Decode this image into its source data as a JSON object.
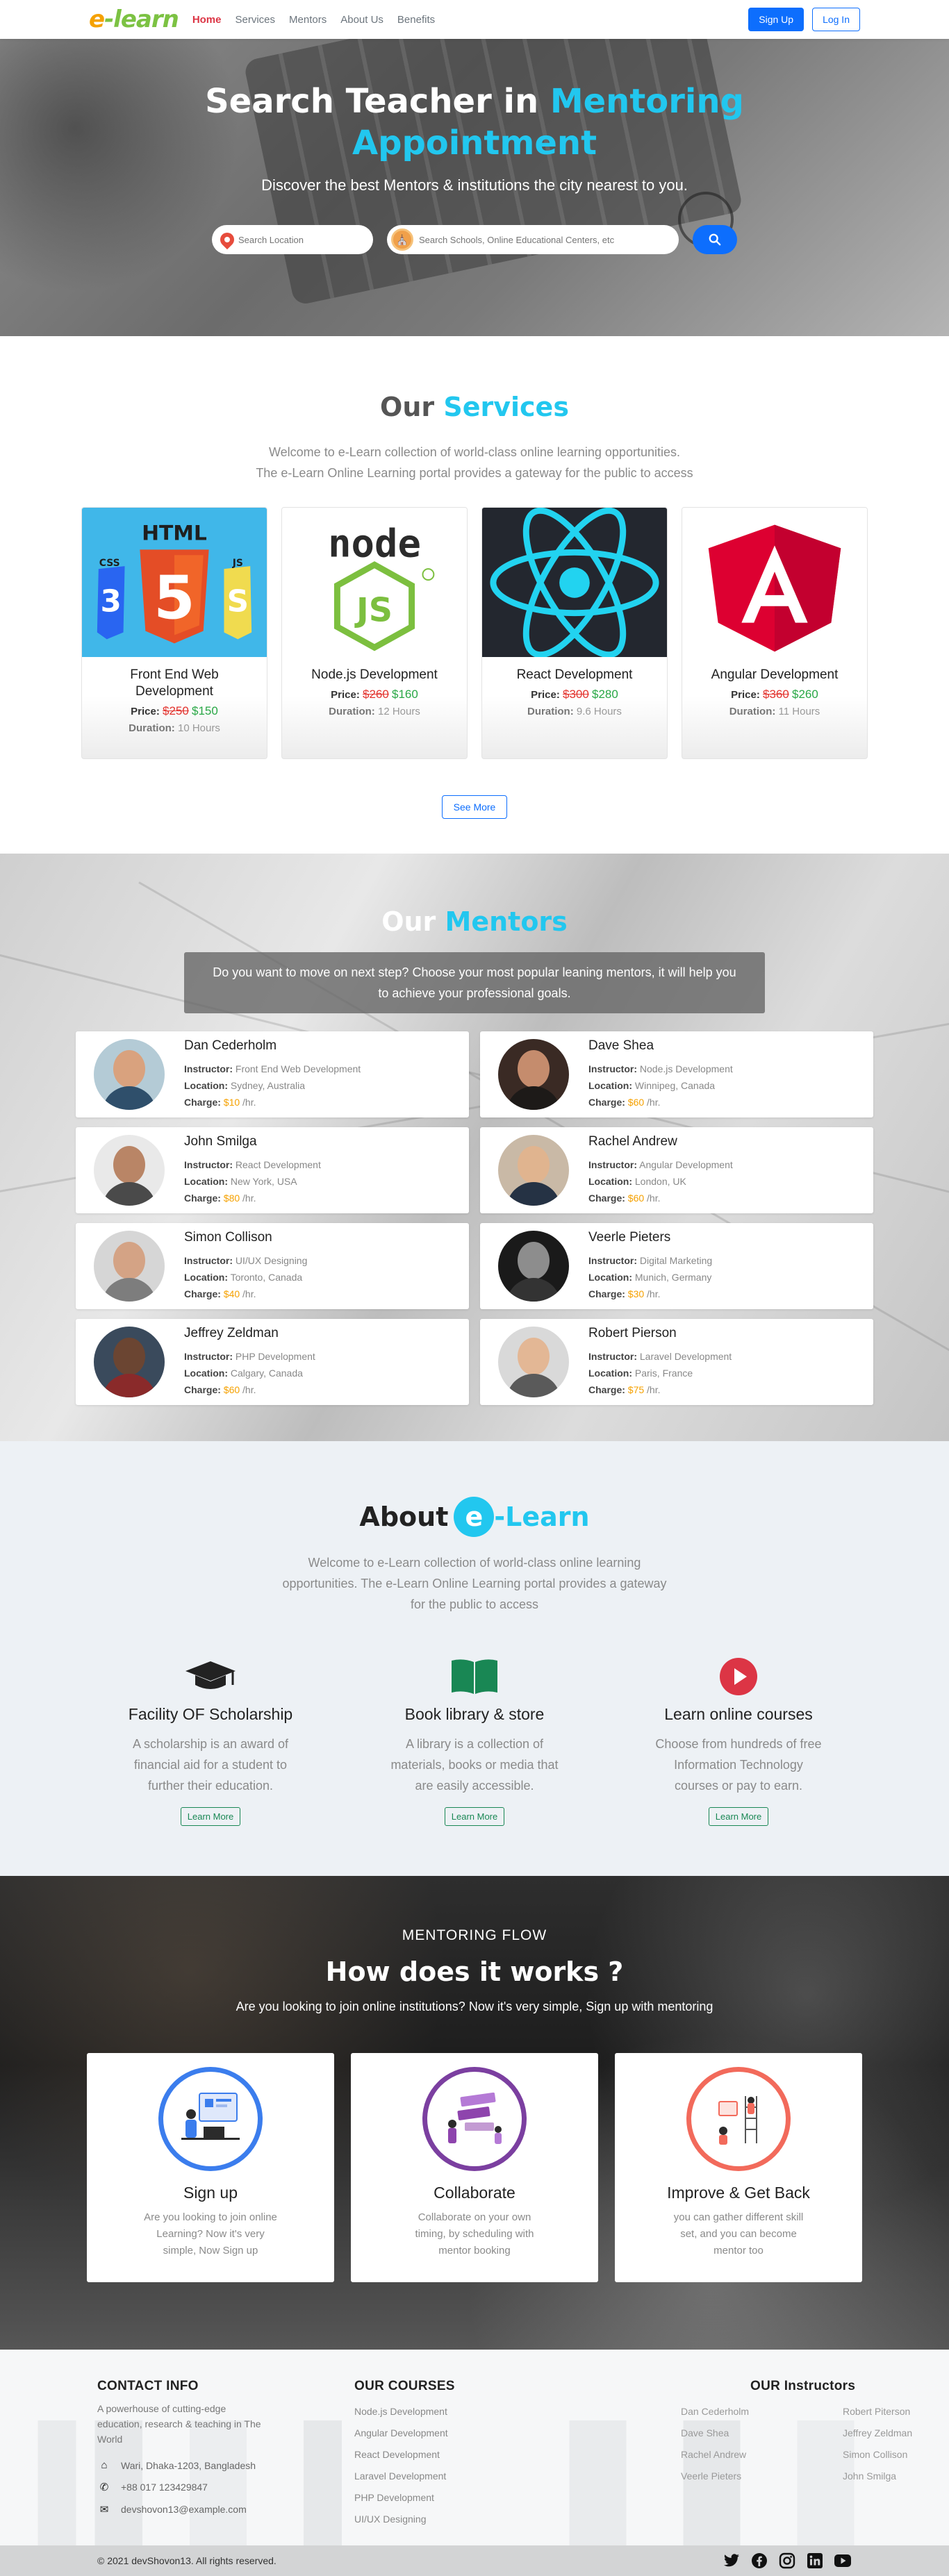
{
  "nav": {
    "logo_e": "e",
    "logo_rest": "-learn",
    "links": [
      "Home",
      "Services",
      "Mentors",
      "About Us",
      "Benefits"
    ],
    "signup": "Sign Up",
    "login": "Log In"
  },
  "hero": {
    "title_plain": "Search Teacher in ",
    "title_highlight": "Mentoring Appointment",
    "subtitle": "Discover the best Mentors & institutions the city nearest to you.",
    "location_placeholder": "Search Location",
    "search_placeholder": "Search Schools, Online Educational Centers, etc"
  },
  "services": {
    "title_plain": "Our ",
    "title_highlight": "Services",
    "desc_line1": "Welcome to e-Learn collection of world-class online learning opportunities.",
    "desc_line2": "The e-Learn Online Learning portal provides a gateway for the public to access",
    "price_label": "Price:",
    "duration_label": "Duration:",
    "see_more": "See More",
    "courses": [
      {
        "title": "Front End Web Development",
        "old_price": "$250",
        "new_price": "$150",
        "duration": "10 Hours",
        "icon": "html-css-js-logo"
      },
      {
        "title": "Node.js Development",
        "old_price": "$260",
        "new_price": "$160",
        "duration": "12 Hours",
        "icon": "nodejs-logo"
      },
      {
        "title": "React Development",
        "old_price": "$300",
        "new_price": "$280",
        "duration": "9.6 Hours",
        "icon": "react-logo"
      },
      {
        "title": "Angular Development",
        "old_price": "$360",
        "new_price": "$260",
        "duration": "11 Hours",
        "icon": "angular-logo"
      }
    ]
  },
  "mentors": {
    "title_plain": "Our ",
    "title_highlight": "Mentors",
    "intro": "Do you want to move on next step? Choose your most popular leaning mentors, it will help you to achieve your professional goals.",
    "instructor_label": "Instructor:",
    "location_label": "Location:",
    "charge_label": "Charge:",
    "list": [
      {
        "name": "Dan Cederholm",
        "instructor": "Front End Web Development",
        "location": "Sydney, Australia",
        "charge": "$10",
        "per": " /hr."
      },
      {
        "name": "Dave Shea",
        "instructor": "Node.js Development",
        "location": "Winnipeg, Canada",
        "charge": "$60",
        "per": " /hr."
      },
      {
        "name": "John Smilga",
        "instructor": "React Development",
        "location": "New York, USA",
        "charge": "$80",
        "per": " /hr."
      },
      {
        "name": "Rachel Andrew",
        "instructor": "Angular Development",
        "location": "London, UK",
        "charge": "$60",
        "per": " /hr."
      },
      {
        "name": "Simon Collison",
        "instructor": "UI/UX Designing",
        "location": "Toronto, Canada",
        "charge": "$40",
        "per": " /hr."
      },
      {
        "name": "Veerle Pieters",
        "instructor": "Digital Marketing",
        "location": "Munich, Germany",
        "charge": "$30",
        "per": " /hr."
      },
      {
        "name": "Jeffrey Zeldman",
        "instructor": "PHP Development",
        "location": "Calgary, Canada",
        "charge": "$60",
        "per": " /hr."
      },
      {
        "name": "Robert Pierson",
        "instructor": "Laravel Development",
        "location": "Paris, France",
        "charge": "$75",
        "per": " /hr."
      }
    ]
  },
  "about": {
    "title_plain": "About ",
    "title_circle": "e",
    "title_highlight": "-Learn",
    "desc": "Welcome to e-Learn collection of world-class online learning opportunities. The e-Learn Online Learning portal provides a gateway for the public to access",
    "features": [
      {
        "title": "Facility OF Scholarship",
        "desc": "A scholarship is an award of financial aid for a student to further their education.",
        "button": "Learn More",
        "icon": "graduation-cap-icon"
      },
      {
        "title": "Book library & store",
        "desc": "A library is a collection of materials, books or media that are easily accessible.",
        "button": "Learn More",
        "icon": "book-icon"
      },
      {
        "title": "Learn online courses",
        "desc": "Choose from hundreds of free Information Technology courses or pay to earn.",
        "button": "Learn More",
        "icon": "play-circle-icon"
      }
    ]
  },
  "how": {
    "kicker": "MENTORING FLOW",
    "title": "How does it works ?",
    "subtitle": "Are you looking to join online institutions? Now it's very simple, Sign up with mentoring",
    "steps": [
      {
        "title": "Sign up",
        "desc": "Are you looking to join online Learning? Now it's very simple, Now Sign up",
        "color": "#3b7ded"
      },
      {
        "title": "Collaborate",
        "desc": "Collaborate on your own timing, by scheduling with mentor booking",
        "color": "#7b3fa0"
      },
      {
        "title": "Improve & Get Back",
        "desc": "you can gather different skill set, and you can become mentor too",
        "color": "#f26a5b"
      }
    ]
  },
  "footer": {
    "contact_title": "CONTACT INFO",
    "tagline": "A powerhouse of cutting-edge education, research & teaching in The World",
    "address": "Wari, Dhaka-1203, Bangladesh",
    "phone": "+88 017 123429847",
    "email": "devshovon13@example.com",
    "courses_title": "OUR COURSES",
    "courses": [
      "Node.js Development",
      "Angular Development",
      "React Development",
      "Laravel Development",
      "PHP Development",
      "UI/UX Designing"
    ],
    "instructors_title": "OUR Instructors",
    "instructors": [
      "Dan Cederholm",
      "Robert Piterson",
      "Dave Shea",
      "Jeffrey Zeldman",
      "Rachel Andrew",
      "Simon Collison",
      "Veerle Pieters",
      "John Smilga"
    ],
    "copyright": "© 2021 devShovon13. All rights reserved."
  }
}
